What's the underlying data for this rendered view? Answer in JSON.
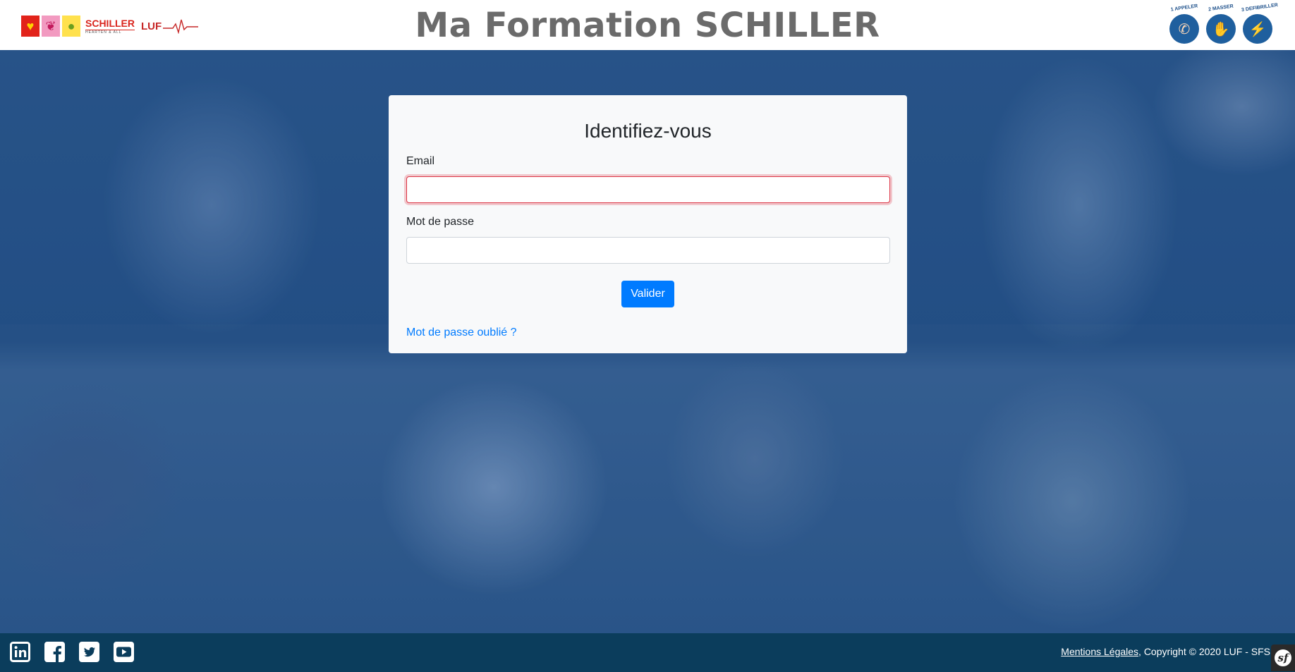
{
  "header": {
    "title": "Ma Formation SCHILLER",
    "left_logos": {
      "schiller_word": "SCHILLER",
      "schiller_sub": "HEARTEN & ALL",
      "luf_word": "LUF"
    },
    "steps": [
      {
        "label": "1 APPELER",
        "icon": "phone-hand-icon"
      },
      {
        "label": "2 MASSER",
        "icon": "hand-icon"
      },
      {
        "label": "3 DEFIBRILLER",
        "icon": "defibrillator-icon"
      }
    ]
  },
  "login": {
    "title": "Identifiez-vous",
    "email_label": "Email",
    "email_value": "",
    "password_label": "Mot de passe",
    "password_value": "",
    "submit_label": "Valider",
    "forgot_label": "Mot de passe oublié ?"
  },
  "footer": {
    "legal_link": "Mentions Légales",
    "copyright": ", Copyright © 2020 LUF - SFS",
    "social": [
      "linkedin-icon",
      "facebook-icon",
      "twitter-icon",
      "youtube-icon"
    ],
    "symfony_badge": "sf"
  },
  "colors": {
    "primary": "#007bff",
    "footer_bg": "#0b3d5c",
    "invalid_border": "#dc3545",
    "title_gray": "#6b6b6b"
  }
}
